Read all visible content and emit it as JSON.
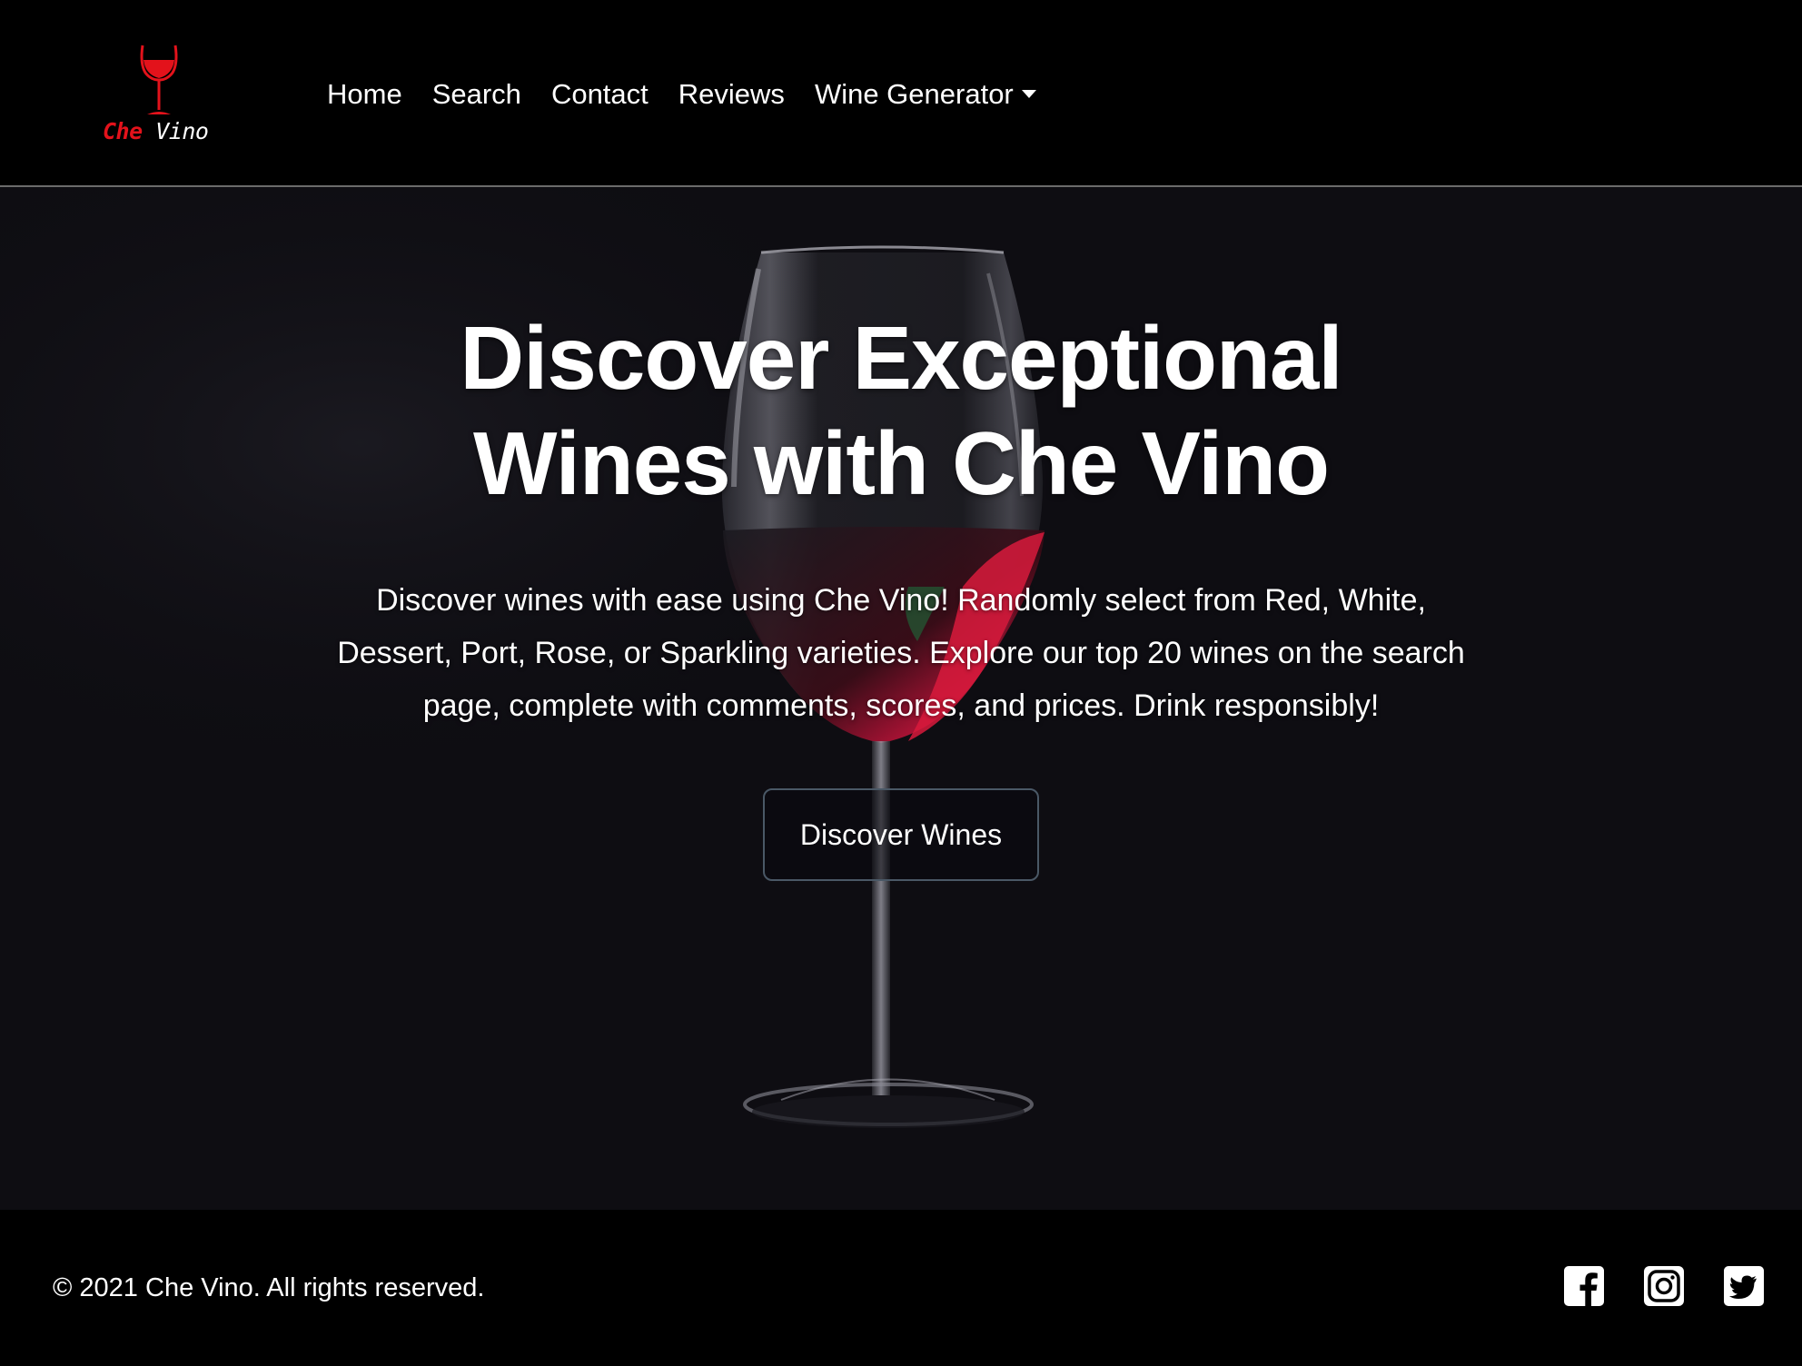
{
  "brand": {
    "name_part1": "Che",
    "name_part2": "Vino",
    "accent_color": "#e3121b",
    "logo_icon": "wine-glass-icon"
  },
  "nav": {
    "items": [
      {
        "label": "Home"
      },
      {
        "label": "Search"
      },
      {
        "label": "Contact"
      },
      {
        "label": "Reviews"
      },
      {
        "label": "Wine Generator",
        "has_dropdown": true
      }
    ]
  },
  "hero": {
    "title_line1": "Discover Exceptional",
    "title_line2": "Wines with Che Vino",
    "description": "Discover wines with ease using Che Vino! Randomly select from Red, White, Dessert, Port, Rose, or Sparkling varieties. Explore our top 20 wines on the search page, complete with comments, scores, and prices. Drink responsibly!",
    "cta_label": "Discover Wines",
    "background_image": "wine-glass-photo"
  },
  "footer": {
    "copyright": "© 2021 Che Vino. All rights reserved.",
    "social": [
      {
        "icon": "facebook-icon"
      },
      {
        "icon": "instagram-icon"
      },
      {
        "icon": "twitter-icon"
      }
    ]
  }
}
